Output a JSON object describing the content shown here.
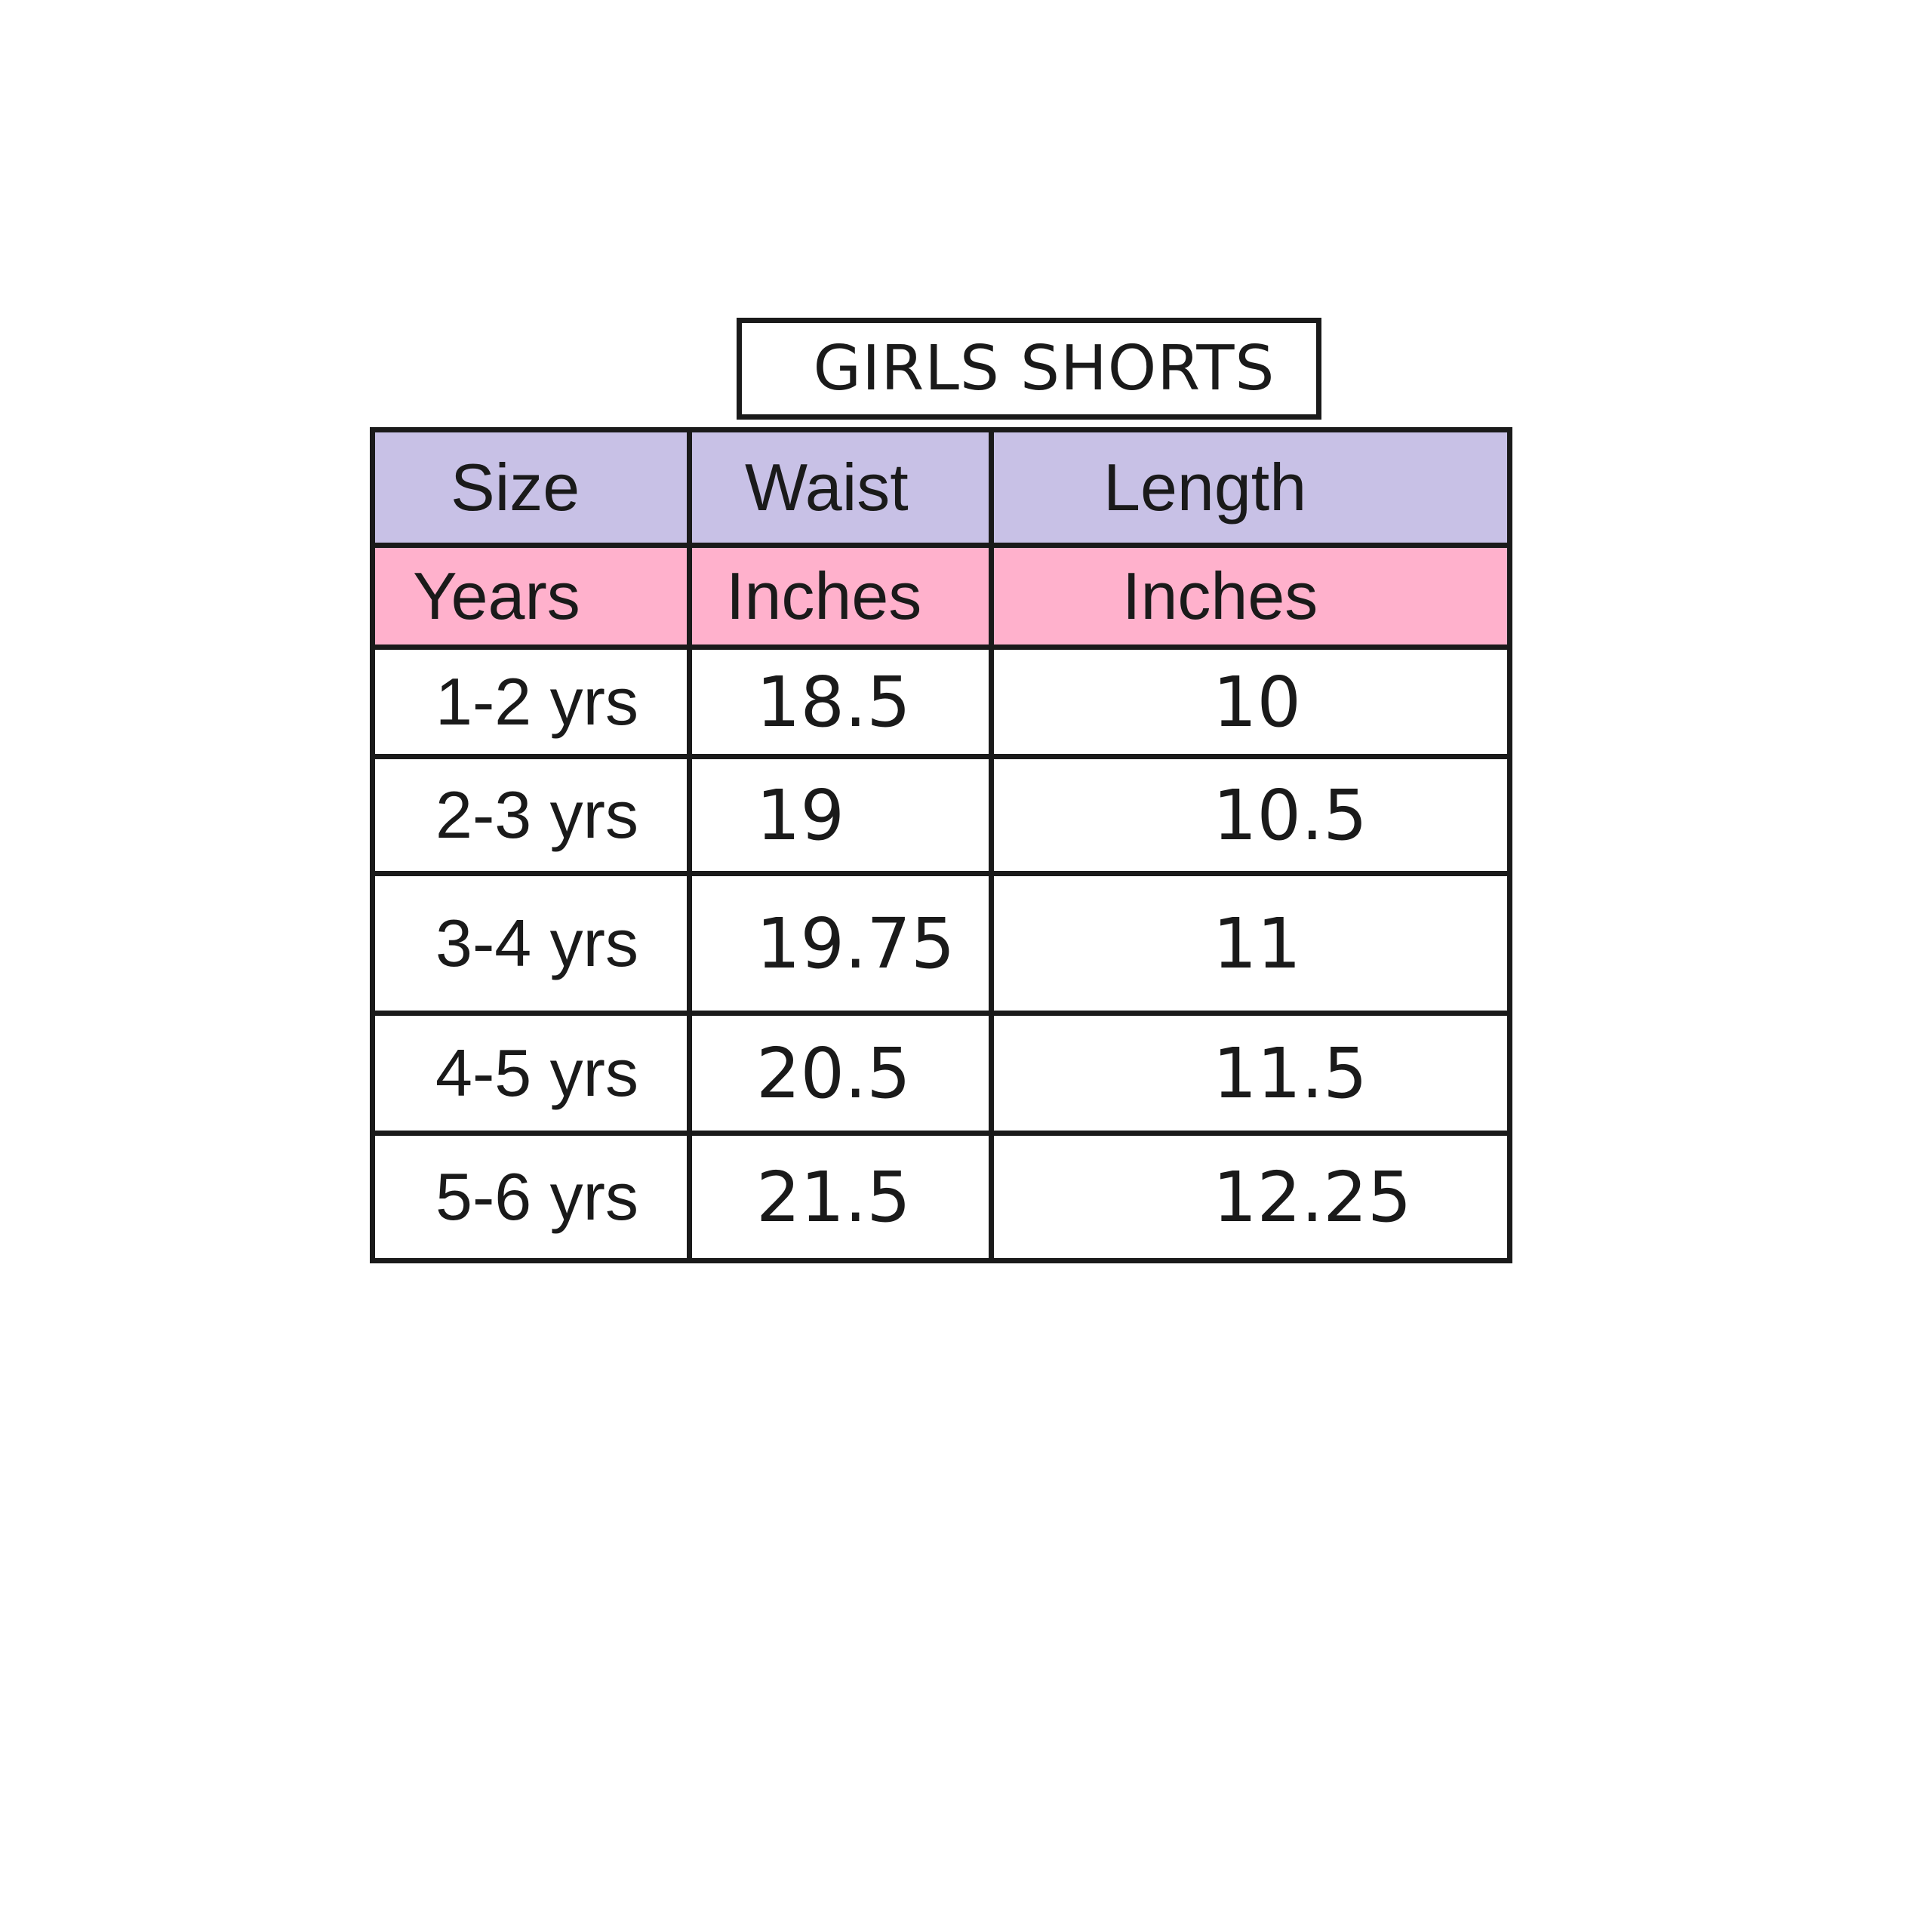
{
  "title": "GIRLS SHORTS",
  "table": {
    "headers": [
      "Size",
      "Waist",
      "Length"
    ],
    "units": [
      "Years",
      "Inches",
      "Inches"
    ],
    "rows": [
      [
        "1-2 yrs",
        "18.5",
        "10"
      ],
      [
        "2-3 yrs",
        "19",
        "10.5"
      ],
      [
        "3-4 yrs",
        "19.75",
        "11"
      ],
      [
        "4-5 yrs",
        "20.5",
        "11.5"
      ],
      [
        "5-6 yrs",
        "21.5",
        "12.25"
      ]
    ]
  },
  "colors": {
    "header_row": "#c8c1e6",
    "unit_row": "#ffb1cc",
    "border": "#1a1a1a",
    "background": "#ffffff"
  }
}
